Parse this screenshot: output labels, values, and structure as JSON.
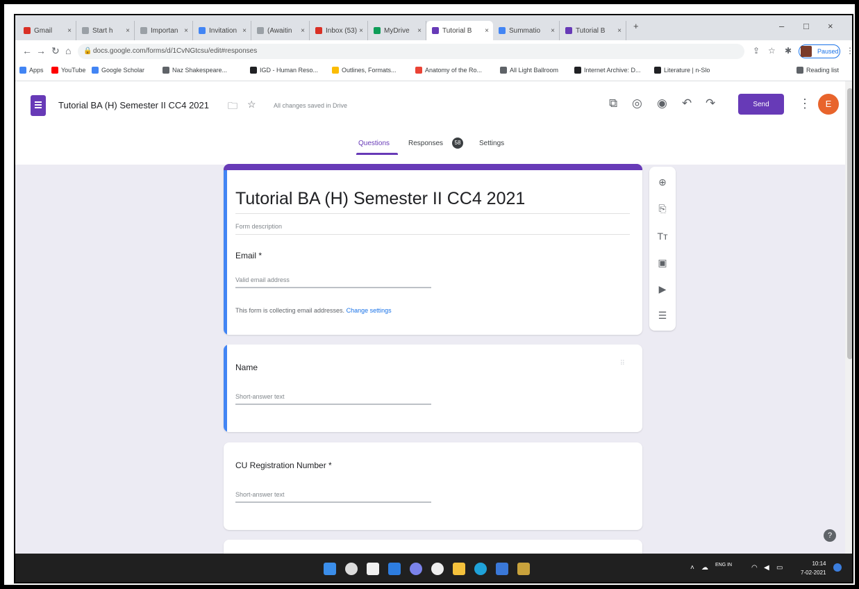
{
  "browser": {
    "tabs": [
      {
        "label": "Gmail",
        "color": "#d93025"
      },
      {
        "label": "Start h",
        "color": "#5f6368"
      },
      {
        "label": "Importan",
        "color": "#5f6368"
      },
      {
        "label": "Invitation",
        "color": "#4285f4"
      },
      {
        "label": "(Awaitin",
        "color": "#5f6368"
      },
      {
        "label": "Inbox (53)",
        "color": "#d93025"
      },
      {
        "label": "MyDrive",
        "color": "#0f9d58"
      },
      {
        "label": "Tutorial B",
        "color": "#673ab7"
      },
      {
        "label": "Summatio",
        "color": "#4285f4"
      },
      {
        "label": "Tutorial B",
        "color": "#673ab7"
      }
    ],
    "url": "docs.google.com/forms/d/1CvNGtcsu/edit#responses",
    "profile_label": "Paused",
    "bookmarks": [
      {
        "label": "Apps",
        "color": "#4285f4"
      },
      {
        "label": "YouTube",
        "color": "#ff0000"
      },
      {
        "label": "Google Scholar",
        "color": "#4285f4"
      },
      {
        "label": "Naz Shakespeare...",
        "color": "#5f6368"
      },
      {
        "label": "IGD - Human Reso...",
        "color": "#202124"
      },
      {
        "label": "Outlines, Formats...",
        "color": "#fbbc04"
      },
      {
        "label": "Anatomy of the Ro...",
        "color": "#ea4335"
      },
      {
        "label": "All Light Ballroom",
        "color": "#5f6368"
      },
      {
        "label": "Internet Archive: D...",
        "color": "#202124"
      },
      {
        "label": "Literature | n-Slo",
        "color": "#202124"
      },
      {
        "label": "Reading list",
        "color": "#5f6368"
      }
    ]
  },
  "forms_header": {
    "doc_title": "Tutorial BA (H) Semester II CC4 2021",
    "saved_status": "All changes saved in Drive",
    "send_label": "Send",
    "avatar_letter": "E",
    "tabs": {
      "questions": "Questions",
      "responses": "Responses",
      "responses_count": "58",
      "settings": "Settings"
    }
  },
  "form": {
    "title": "Tutorial BA (H) Semester II CC4 2021",
    "description_placeholder": "Form description",
    "email_label": "Email *",
    "email_placeholder": "Valid email address",
    "collect_text": "This form is collecting email addresses.",
    "change_settings": "Change settings",
    "questions": [
      {
        "label": "Name",
        "answer_placeholder": "Short-answer text"
      },
      {
        "label": "CU Registration Number *",
        "answer_placeholder": "Short-answer text"
      }
    ]
  },
  "taskbar": {
    "lang": "ENG IN",
    "time": "10:14",
    "date": "7-02-2021"
  }
}
